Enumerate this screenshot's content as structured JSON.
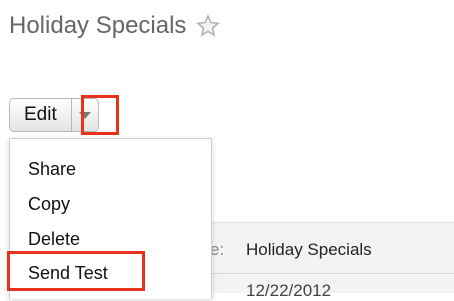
{
  "header": {
    "title": "Holiday Specials",
    "favorite_icon": "star-outline-icon"
  },
  "actions": {
    "edit_label": "Edit",
    "toggle_icon": "caret-down-icon"
  },
  "menu": {
    "items": [
      {
        "label": "Share"
      },
      {
        "label": "Copy"
      },
      {
        "label": "Delete"
      },
      {
        "label": "Send Test"
      }
    ]
  },
  "detail": {
    "label_fragment": "e:",
    "name_value": "Holiday Specials",
    "date_fragment": "12/22/2012"
  },
  "colors": {
    "highlight": "#e8331c",
    "title_text": "#666666"
  }
}
